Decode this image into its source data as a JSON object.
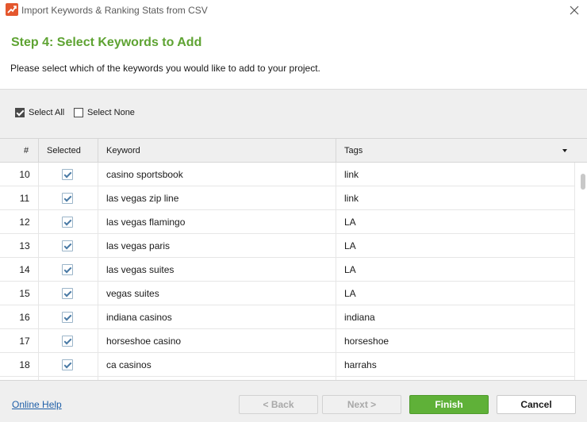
{
  "window": {
    "title": "Import Keywords & Ranking Stats from CSV",
    "icon": "chart-trend-icon",
    "close_icon": "close-icon"
  },
  "header": {
    "step_title": "Step 4: Select Keywords to Add",
    "description": "Please select which of the keywords you would like to add to your project."
  },
  "selector": {
    "select_all_label": "Select All",
    "select_all_checked": true,
    "select_none_label": "Select None",
    "select_none_checked": false
  },
  "table": {
    "columns": [
      "#",
      "Selected",
      "Keyword",
      "Tags"
    ],
    "rows": [
      {
        "num": "10",
        "selected": true,
        "keyword": "casino sportsbook",
        "tags": "link"
      },
      {
        "num": "11",
        "selected": true,
        "keyword": "las vegas zip line",
        "tags": "link"
      },
      {
        "num": "12",
        "selected": true,
        "keyword": "las vegas flamingo",
        "tags": "LA"
      },
      {
        "num": "13",
        "selected": true,
        "keyword": "las vegas paris",
        "tags": "LA"
      },
      {
        "num": "14",
        "selected": true,
        "keyword": "las vegas suites",
        "tags": "LA"
      },
      {
        "num": "15",
        "selected": true,
        "keyword": "vegas suites",
        "tags": "LA"
      },
      {
        "num": "16",
        "selected": true,
        "keyword": "indiana casinos",
        "tags": "indiana"
      },
      {
        "num": "17",
        "selected": true,
        "keyword": "horseshoe casino",
        "tags": "horseshoe"
      },
      {
        "num": "18",
        "selected": true,
        "keyword": "ca casinos",
        "tags": "harrahs"
      }
    ]
  },
  "footer": {
    "help_link": "Online Help",
    "back_label": "< Back",
    "next_label": "Next >",
    "finish_label": "Finish",
    "cancel_label": "Cancel"
  },
  "colors": {
    "accent_green": "#5ea332",
    "finish_green": "#5fb138",
    "link_blue": "#1f5fa8"
  }
}
